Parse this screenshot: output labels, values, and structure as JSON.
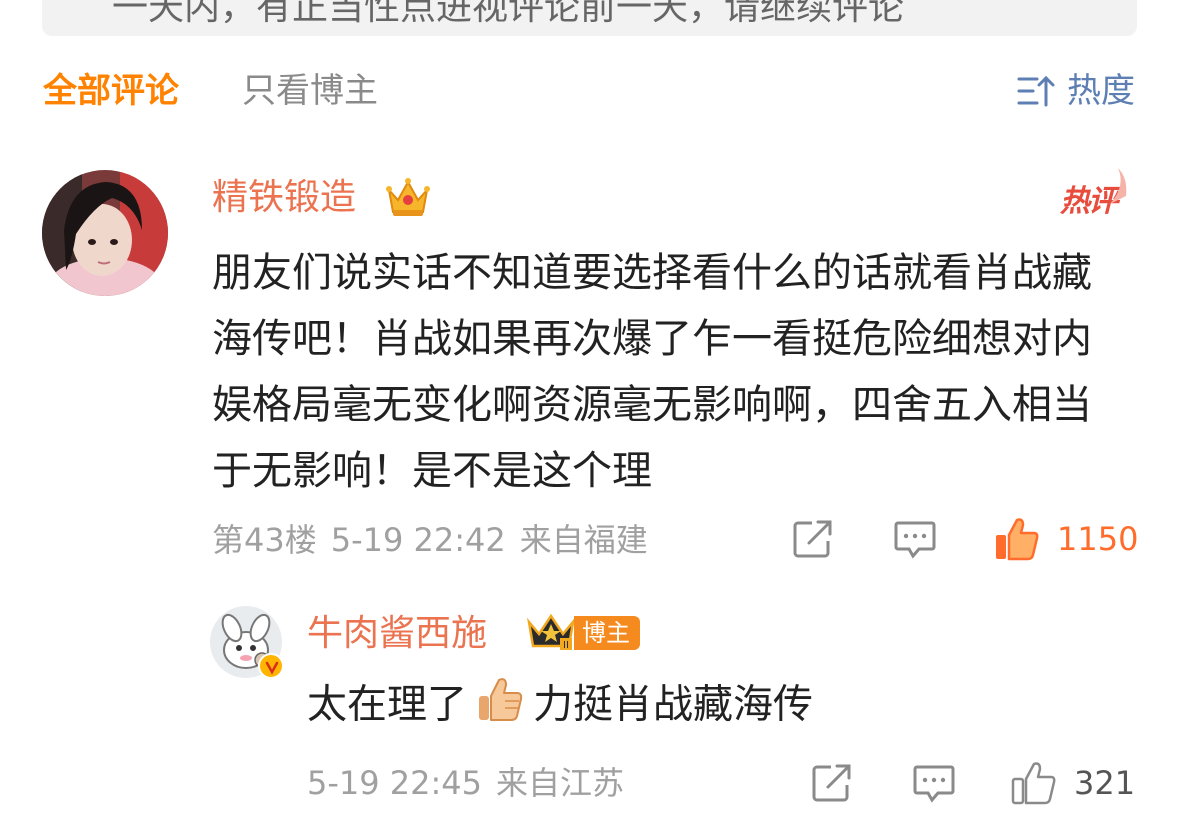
{
  "quote_preview": "一天内，有正当性点进视评论前一天，请继续评论",
  "tabs": {
    "all": "全部评论",
    "blogger_only": "只看博主"
  },
  "sort": {
    "label": "热度"
  },
  "colors": {
    "accent": "#ff8200",
    "username": "#eb7350",
    "link_blue": "#5d7fb3",
    "like_active": "#ff6c2b"
  },
  "comment": {
    "username": "精铁锻造",
    "hot_badge": "热评",
    "text": "朋友们说实话不知道要选择看什么的话就看肖战藏海传吧！肖战如果再次爆了乍一看挺危险细想对内娱格局毫无变化啊资源毫无影响啊，四舍五入相当于无影响！是不是这个理",
    "floor": "第43楼",
    "time": "5-19 22:42",
    "location": "来自福建",
    "likes": "1150",
    "icons": {
      "share": "share-icon",
      "comment": "comment-icon",
      "like": "thumbs-up-icon"
    }
  },
  "reply": {
    "username": "牛肉酱西施",
    "badge": "博主",
    "text_before": "太在理了",
    "text_after": "力挺肖战藏海传",
    "emoji": "thumbs-up-emoji",
    "time": "5-19 22:45",
    "location": "来自江苏",
    "likes": "321"
  }
}
